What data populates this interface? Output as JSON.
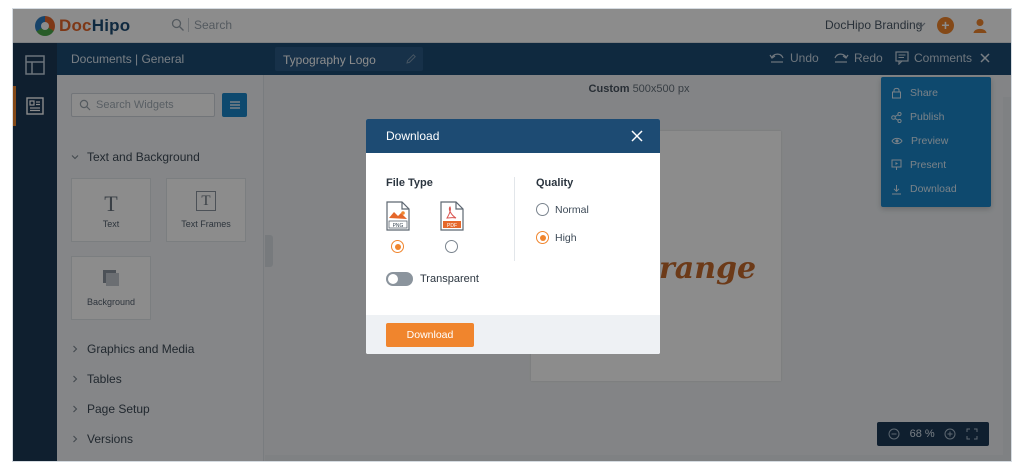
{
  "app": {
    "logo_left": "Doc",
    "logo_right": "Hipo",
    "search_placeholder": "Search",
    "brand_name": "DocHipo Branding",
    "add_symbol": "+"
  },
  "nav": {
    "doc_path": "Documents | General",
    "doc_name": "Typography Logo",
    "undo_label": "Undo",
    "redo_label": "Redo",
    "comments_label": "Comments"
  },
  "sidebar": {
    "search_placeholder": "Search Widgets",
    "sections": {
      "text_background": "Text and Background",
      "graphics_media": "Graphics and Media",
      "tables": "Tables",
      "page_setup": "Page Setup",
      "versions": "Versions"
    },
    "tiles": {
      "text": "Text",
      "text_frames": "Text Frames",
      "background": "Background"
    },
    "tile_glyphs": {
      "text": "T",
      "text_frames": "T"
    }
  },
  "canvas": {
    "size_label": "Custom",
    "size_value": "500x500 px",
    "artboard_text": "range",
    "zoom_value": "68",
    "zoom_unit": "%"
  },
  "share_menu": {
    "items": [
      "Share",
      "Publish",
      "Preview",
      "Present",
      "Download"
    ]
  },
  "modal": {
    "title": "Download",
    "file_type_label": "File Type",
    "file_types": [
      {
        "label": "PNG",
        "selected": true
      },
      {
        "label": "PDF",
        "selected": false
      }
    ],
    "quality_label": "Quality",
    "quality_options": [
      {
        "label": "Normal",
        "selected": false
      },
      {
        "label": "High",
        "selected": true
      }
    ],
    "transparent_label": "Transparent",
    "transparent_on": false,
    "download_button": "Download"
  },
  "colors": {
    "primary_dark": "#1d4b73",
    "accent": "#f0852d",
    "menu_blue": "#1a86c8"
  }
}
